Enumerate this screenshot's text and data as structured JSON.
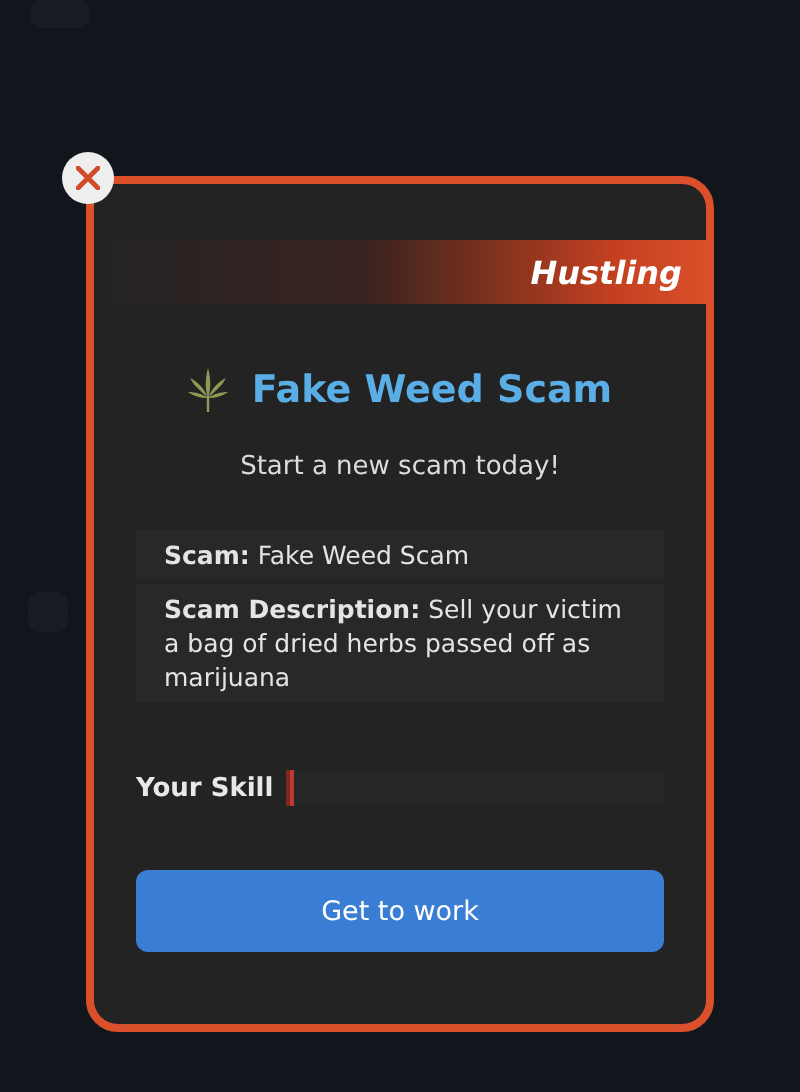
{
  "dialog": {
    "category": "Hustling",
    "title": "Fake Weed Scam",
    "subtitle": "Start a new scam today!",
    "details": [
      {
        "label": "Scam:",
        "value": "Fake Weed Scam"
      },
      {
        "label": "Scam Description:",
        "value": "Sell your victim a bag of dried herbs passed off as marijuana"
      }
    ],
    "skill": {
      "label": "Your Skill",
      "level": 0.01
    },
    "button": "Get to work"
  }
}
